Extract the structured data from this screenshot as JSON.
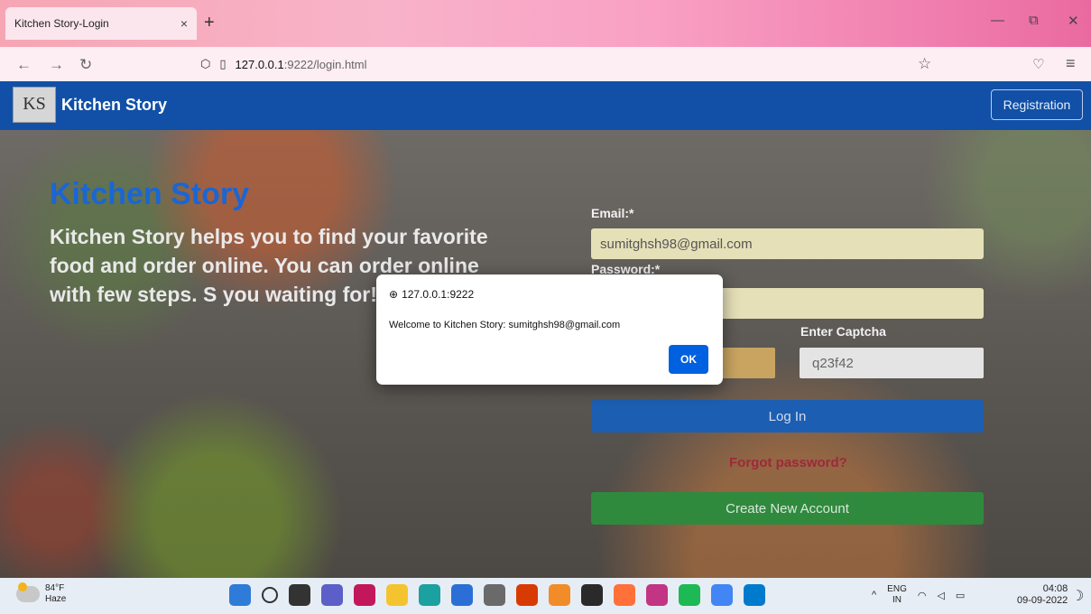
{
  "browser": {
    "tab_title": "Kitchen Story-Login",
    "tab_close": "×",
    "new_tab": "+",
    "url_host": "127.0.0.1",
    "url_path": ":9222/login.html"
  },
  "header": {
    "logo_text": "KS",
    "brand": "Kitchen Story",
    "registration_button": "Registration"
  },
  "hero": {
    "title": "Kitchen Story",
    "text": "Kitchen Story helps you to find your favorite food and order online. You can order online with few steps. S you waiting for!!"
  },
  "form": {
    "email_label": "Email:*",
    "email_value": "sumitghsh98@gmail.com",
    "password_label": "Password:*",
    "captcha_label": "Enter Captcha",
    "captcha_value": "q23f42",
    "login_button": "Log In",
    "forgot_link": "Forgot password?",
    "create_button": "Create New Account"
  },
  "dialog": {
    "origin": "127.0.0.1:9222",
    "message": "Welcome to Kitchen Story: sumitghsh98@gmail.com",
    "ok_button": "OK"
  },
  "taskbar": {
    "weather_temp": "84°F",
    "weather_desc": "Haze",
    "lang_top": "ENG",
    "lang_bottom": "IN",
    "time": "04:08",
    "date": "09-09-2022",
    "icons": [
      {
        "name": "windows-start-icon",
        "color": "#2f7bd8"
      },
      {
        "name": "search-icon",
        "color": "#e7edf4"
      },
      {
        "name": "task-view-icon",
        "color": "#333333"
      },
      {
        "name": "chat-icon",
        "color": "#5b5fc7"
      },
      {
        "name": "intellij-icon",
        "color": "#c2185b"
      },
      {
        "name": "file-explorer-icon",
        "color": "#f4c430"
      },
      {
        "name": "edge-icon",
        "color": "#1aa1a0"
      },
      {
        "name": "store-icon",
        "color": "#2b6fd6"
      },
      {
        "name": "app-icon",
        "color": "#6a6a6a"
      },
      {
        "name": "office-icon",
        "color": "#d83b01"
      },
      {
        "name": "sublime-icon",
        "color": "#f28c28"
      },
      {
        "name": "terminal-icon",
        "color": "#2a2a2a"
      },
      {
        "name": "firefox-icon",
        "color": "#ff7139"
      },
      {
        "name": "instagram-icon",
        "color": "#c13584"
      },
      {
        "name": "spotify-icon",
        "color": "#1db954"
      },
      {
        "name": "chrome-icon",
        "color": "#4285f4"
      },
      {
        "name": "vscode-icon",
        "color": "#007acc"
      }
    ]
  }
}
